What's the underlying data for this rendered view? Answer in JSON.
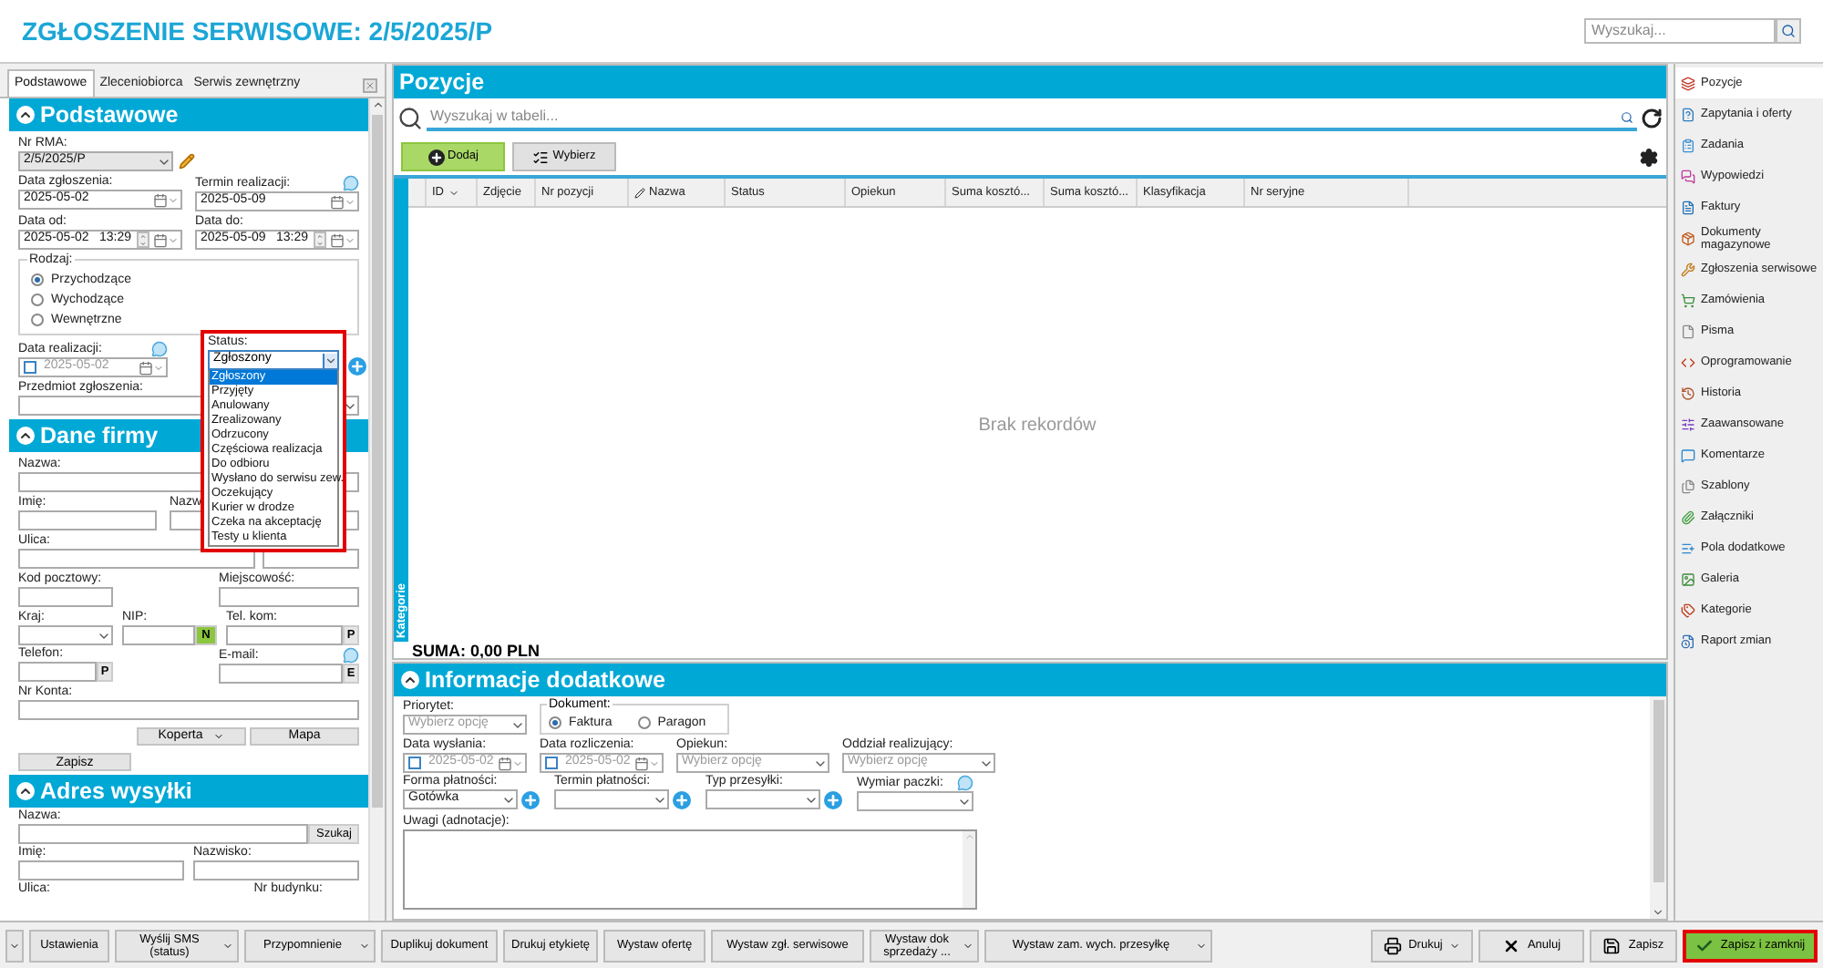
{
  "header": {
    "title": "ZGŁOSZENIE SERWISOWE: 2/5/2025/P",
    "search": {
      "placeholder": "Wyszukaj..."
    }
  },
  "left_tabs": [
    {
      "label": "Podstawowe",
      "selected": true
    },
    {
      "label": "Zleceniobiorca",
      "selected": false
    },
    {
      "label": "Serwis zewnętrzny",
      "selected": false
    }
  ],
  "podstawowe": {
    "title": "Podstawowe",
    "nr_rma": {
      "label": "Nr RMA:",
      "value": "2/5/2025/P"
    },
    "data_zgloszenia": {
      "label": "Data zgłoszenia:",
      "value": "2025-05-02"
    },
    "termin_realizacji": {
      "label": "Termin realizacji:",
      "value": "2025-05-09"
    },
    "data_od": {
      "label": "Data od:",
      "value": "2025-05-02",
      "time": "13:29"
    },
    "data_do": {
      "label": "Data do:",
      "value": "2025-05-09",
      "time": "13:29"
    },
    "rodzaj": {
      "legend": "Rodzaj:",
      "options": [
        {
          "label": "Przychodzące",
          "selected": true
        },
        {
          "label": "Wychodzące",
          "selected": false
        },
        {
          "label": "Wewnętrzne",
          "selected": false
        }
      ]
    },
    "data_realizacji": {
      "label": "Data realizacji:",
      "value": "2025-05-02",
      "checked": false
    },
    "status": {
      "label": "Status:",
      "value": "Zgłoszony",
      "expanded": true,
      "options": [
        {
          "label": "Zgłoszony",
          "selected": true
        },
        {
          "label": "Przyjęty",
          "selected": false
        },
        {
          "label": "Anulowany",
          "selected": false
        },
        {
          "label": "Zrealizowany",
          "selected": false
        },
        {
          "label": "Odrzucony",
          "selected": false
        },
        {
          "label": "Częściowa realizacja",
          "selected": false
        },
        {
          "label": "Do odbioru",
          "selected": false
        },
        {
          "label": "Wysłano do serwisu zew.",
          "selected": false
        },
        {
          "label": "Oczekujący",
          "selected": false
        },
        {
          "label": "Kurier w drodze",
          "selected": false
        },
        {
          "label": "Czeka na akceptację",
          "selected": false
        },
        {
          "label": "Testy u klienta",
          "selected": false
        }
      ]
    },
    "przedmiot": {
      "label": "Przedmiot zgłoszenia:"
    }
  },
  "dane_firmy": {
    "title": "Dane firmy",
    "nazwa": {
      "label": "Nazwa:"
    },
    "imie": {
      "label": "Imię:"
    },
    "nazwisko": {
      "label": "Nazw"
    },
    "ulica": {
      "label": "Ulica:"
    },
    "kod": {
      "label": "Kod pocztowy:"
    },
    "miejscowosc": {
      "label": "Miejscowość:"
    },
    "kraj": {
      "label": "Kraj:"
    },
    "nip": {
      "label": "NIP:",
      "button": "N"
    },
    "tel_kom": {
      "label": "Tel. kom:",
      "button": "P"
    },
    "telefon": {
      "label": "Telefon:",
      "button": "P"
    },
    "email": {
      "label": "E-mail:",
      "button": "E"
    },
    "nr_konta": {
      "label": "Nr Konta:"
    },
    "buttons": [
      {
        "label": "Koperta",
        "kind": "menu"
      },
      {
        "label": "Mapa",
        "kind": "plain"
      }
    ],
    "save": "Zapisz"
  },
  "adres_wysylki": {
    "title": "Adres wysyłki",
    "nazwa": {
      "label": "Nazwa:",
      "button": "Szukaj"
    },
    "imie": {
      "label": "Imię:"
    },
    "nazwisko": {
      "label": "Nazwisko:"
    },
    "ulica": {
      "label": "Ulica:"
    },
    "nr_budynku": {
      "label": "Nr budynku:"
    }
  },
  "pozycje": {
    "title": "Pozycje",
    "search": {
      "placeholder": "Wyszukaj w tabeli..."
    },
    "buttons": [
      {
        "label": "Dodaj",
        "kind": "add"
      },
      {
        "label": "Wybierz",
        "kind": "pick"
      }
    ],
    "columns": [
      {
        "label": "ID",
        "kind": "sort"
      },
      {
        "label": "Zdjęcie",
        "kind": "plain"
      },
      {
        "label": "Nr pozycji",
        "kind": "plain"
      },
      {
        "label": "Nazwa",
        "kind": "edit"
      },
      {
        "label": "Status",
        "kind": "plain"
      },
      {
        "label": "Opiekun",
        "kind": "plain"
      },
      {
        "label": "Suma kosztó...",
        "kind": "plain"
      },
      {
        "label": "Suma kosztó...",
        "kind": "plain"
      },
      {
        "label": "Klasyfikacja",
        "kind": "plain"
      },
      {
        "label": "Nr seryjne",
        "kind": "plain"
      }
    ],
    "empty": "Brak rekordów",
    "side_tab": "Kategorie",
    "sum": "SUMA: 0,00 PLN"
  },
  "informacje": {
    "title": "Informacje dodatkowe",
    "priorytet": {
      "label": "Priorytet:",
      "placeholder": "Wybierz opcję"
    },
    "dokument": {
      "legend": "Dokument:",
      "options": [
        {
          "label": "Faktura",
          "selected": true
        },
        {
          "label": "Paragon",
          "selected": false
        }
      ]
    },
    "data_wyslania": {
      "label": "Data wysłania:",
      "value": "2025-05-02",
      "checked": false
    },
    "data_rozliczenia": {
      "label": "Data rozliczenia:",
      "value": "2025-05-02",
      "checked": false
    },
    "opiekun": {
      "label": "Opiekun:",
      "placeholder": "Wybierz opcję"
    },
    "oddzial": {
      "label": "Oddział realizujący:",
      "placeholder": "Wybierz opcję"
    },
    "forma": {
      "label": "Forma płatności:",
      "value": "Gotówka"
    },
    "termin": {
      "label": "Termin płatności:"
    },
    "typ": {
      "label": "Typ przesyłki:"
    },
    "wymiar": {
      "label": "Wymiar paczki:"
    },
    "uwagi": {
      "label": "Uwagi (adnotacje):"
    }
  },
  "sidebar": {
    "items": [
      {
        "label": "Pozycje",
        "selected": true
      },
      {
        "label": "Zapytania i oferty",
        "selected": false
      },
      {
        "label": "Zadania",
        "selected": false
      },
      {
        "label": "Wypowiedzi",
        "selected": false
      },
      {
        "label": "Faktury",
        "selected": false
      },
      {
        "label": "Dokumenty magazynowe",
        "selected": false
      },
      {
        "label": "Zgłoszenia serwisowe",
        "selected": false
      },
      {
        "label": "Zamówienia",
        "selected": false
      },
      {
        "label": "Pisma",
        "selected": false
      },
      {
        "label": "Oprogramowanie",
        "selected": false
      },
      {
        "label": "Historia",
        "selected": false
      },
      {
        "label": "Zaawansowane",
        "selected": false
      },
      {
        "label": "Komentarze",
        "selected": false
      },
      {
        "label": "Szablony",
        "selected": false
      },
      {
        "label": "Załączniki",
        "selected": false
      },
      {
        "label": "Pola dodatkowe",
        "selected": false
      },
      {
        "label": "Galeria",
        "selected": false
      },
      {
        "label": "Kategorie",
        "selected": false
      },
      {
        "label": "Raport zmian",
        "selected": false
      }
    ]
  },
  "toolbar": {
    "left": [
      {
        "label": "Ustawienia",
        "kind": "plain"
      },
      {
        "label": "Wyślij SMS (status)",
        "kind": "menu"
      },
      {
        "label": "Przypomnienie",
        "kind": "menu"
      },
      {
        "label": "Duplikuj dokument",
        "kind": "plain"
      },
      {
        "label": "Drukuj etykietę",
        "kind": "plain"
      },
      {
        "label": "Wystaw ofertę",
        "kind": "plain"
      },
      {
        "label": "Wystaw zgł. serwisowe",
        "kind": "plain"
      },
      {
        "label": "Wystaw dok sprzedaży ...",
        "kind": "menu"
      },
      {
        "label": "Wystaw zam. wych. przesyłkę",
        "kind": "menu"
      }
    ],
    "right": [
      {
        "label": "Drukuj",
        "kind": "print"
      },
      {
        "label": "Anuluj",
        "kind": "cancel"
      },
      {
        "label": "Zapisz",
        "kind": "save"
      },
      {
        "label": "Zapisz i zamknij",
        "kind": "save_close"
      }
    ]
  }
}
